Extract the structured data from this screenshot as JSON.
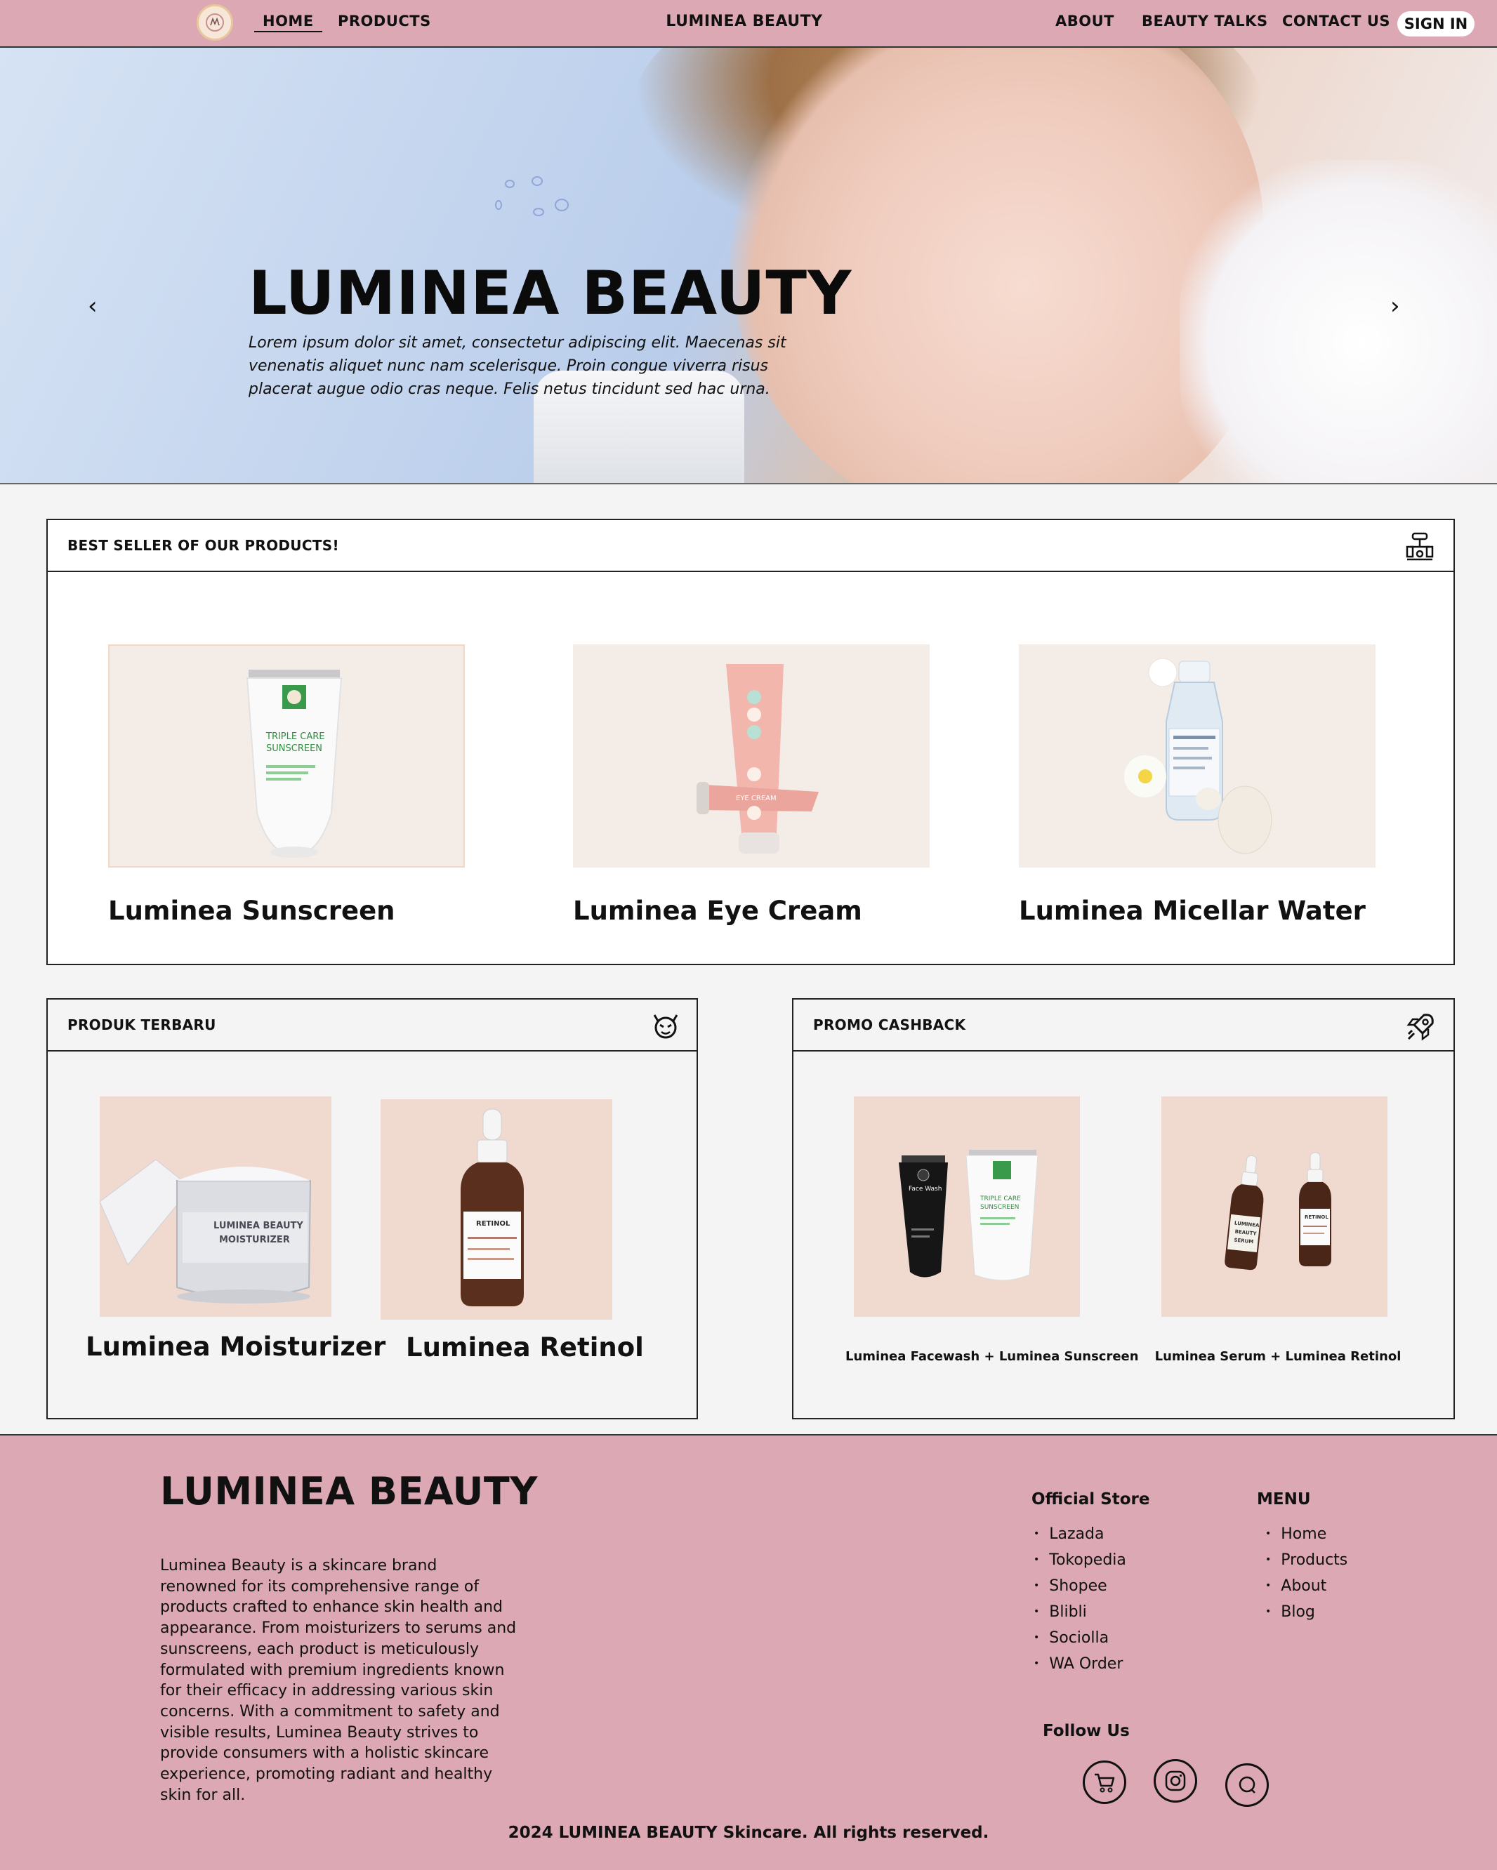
{
  "nav": {
    "home": "HOME",
    "products": "PRODUCTS",
    "brand": "LUMINEA BEAUTY",
    "about": "ABOUT",
    "beauty_talks": "BEAUTY TALKS",
    "contact": "CONTACT US",
    "sign_in": "SIGN IN"
  },
  "hero": {
    "title": "LUMINEA BEAUTY",
    "subtitle": "Lorem ipsum dolor sit amet, consectetur adipiscing elit. Maecenas sit venenatis aliquet nunc nam scelerisque. Proin congue viverra risus placerat augue odio cras neque. Felis netus tincidunt sed hac urna.",
    "prev_arrow": "‹",
    "next_arrow": "›"
  },
  "best_seller": {
    "heading": "BEST SELLER OF OUR PRODUCTS!",
    "products": [
      {
        "name": "Luminea Sunscreen"
      },
      {
        "name": "Luminea Eye Cream"
      },
      {
        "name": "Luminea  Micellar Water"
      }
    ]
  },
  "newest": {
    "heading": "PRODUK TERBARU",
    "products": [
      {
        "name": "Luminea Moisturizer"
      },
      {
        "name": "Luminea Retinol"
      }
    ]
  },
  "promo": {
    "heading": "PROMO CASHBACK",
    "products": [
      {
        "name": "Luminea Facewash + Luminea Sunscreen"
      },
      {
        "name": "Luminea Serum + Luminea Retinol"
      }
    ]
  },
  "footer": {
    "title": "LUMINEA BEAUTY",
    "description": "Luminea Beauty is a skincare brand renowned for its comprehensive range of products crafted to enhance skin health and appearance. From moisturizers to serums and sunscreens, each product is meticulously formulated with premium ingredients known for their efficacy in addressing various skin concerns. With a commitment to safety and visible results, Luminea Beauty strives to provide consumers with a holistic skincare experience, promoting radiant and healthy skin for all.",
    "official_store_heading": "Official Store",
    "stores": [
      "Lazada",
      "Tokopedia",
      "Shopee",
      "Blibli",
      "Sociolla",
      "WA Order"
    ],
    "menu_heading": "MENU",
    "menu": [
      "Home",
      "Products",
      "About",
      "Blog"
    ],
    "follow_heading": "Follow Us",
    "copyright": "2024 LUMINEA BEAUTY Skincare. All rights reserved."
  },
  "product_labels": {
    "sunscreen_line1": "TRIPLE CARE",
    "sunscreen_line2": "SUNSCREEN",
    "eye_cream": "EYE CREAM",
    "moisturizer_line1": "LUMINEA BEAUTY",
    "moisturizer_line2": "MOISTURIZER",
    "retinol": "RETINOL",
    "facewash_line1": "Face Wash",
    "serum_line1": "LUMINEA",
    "serum_line2": "BEAUTY",
    "serum_line3": "SERUM"
  },
  "colors": {
    "nav_bg": "#dba8b3",
    "footer_bg": "#dba8b3",
    "page_bg": "#f4f4f4",
    "card_bg": "#f4ede7",
    "promo_card_bg": "#f0d9cf"
  }
}
